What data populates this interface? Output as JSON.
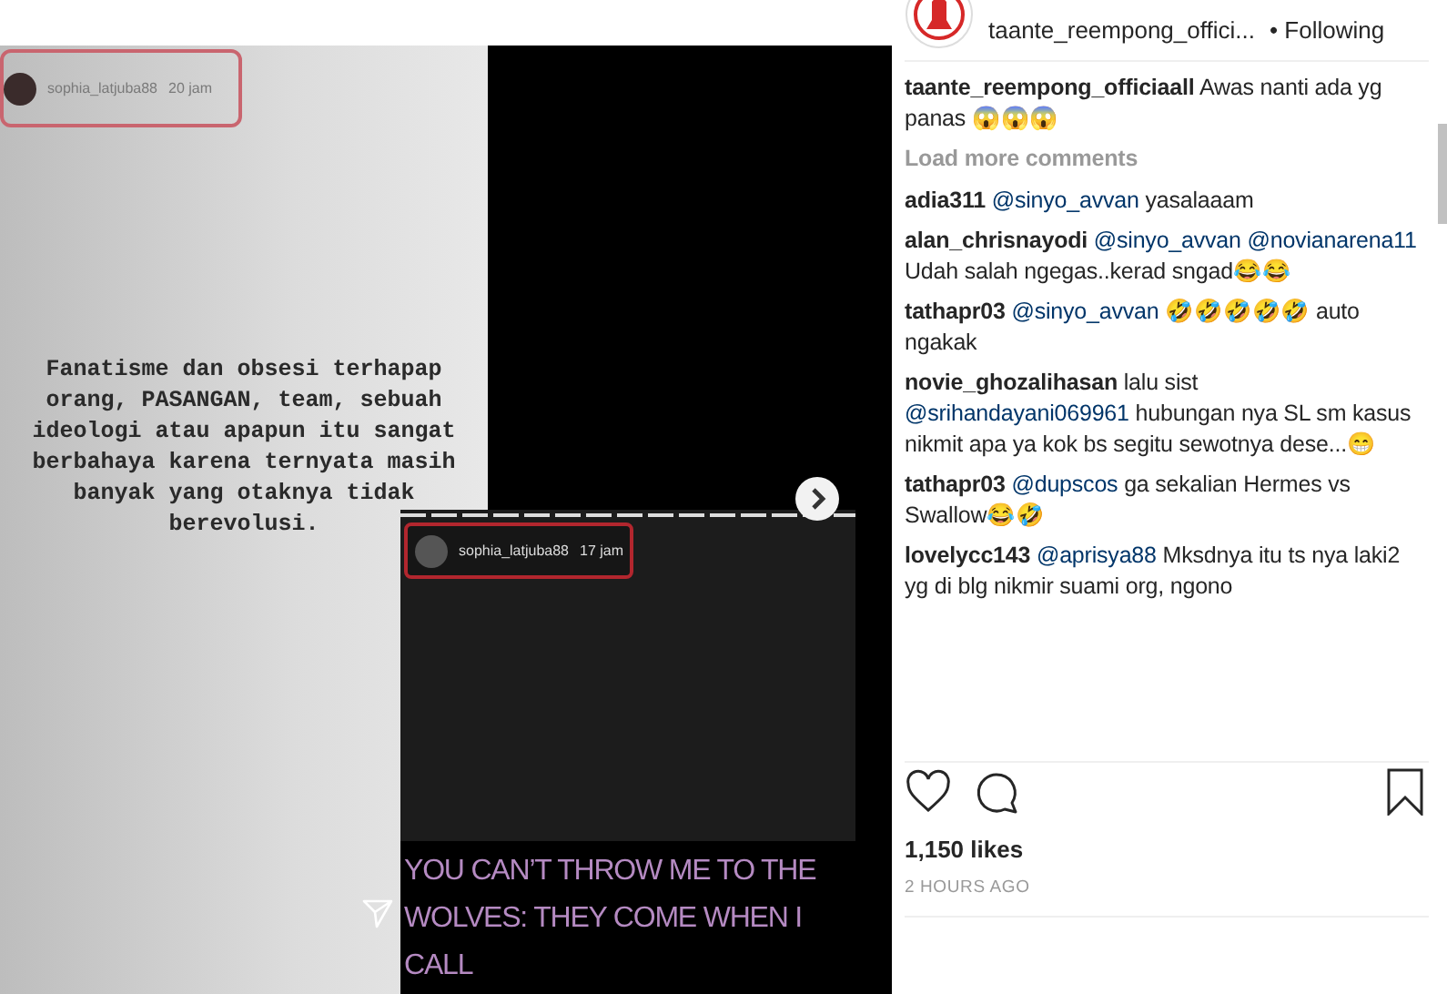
{
  "story": {
    "header": {
      "user": "sophia_latjuba88",
      "time": "20 jam"
    },
    "caption": "Fanatisme dan obsesi terhapap orang, PASANGAN, team, sebuah ideologi atau apapun itu sangat berbahaya karena ternyata masih banyak yang otaknya tidak berevolusi.",
    "inset": {
      "user": "sophia_latjuba88",
      "time": "17 jam",
      "quote": "YOU CAN’T THROW ME TO THE WOLVES: THEY COME WHEN I CALL"
    }
  },
  "post": {
    "account": "taante_reempong_offici...",
    "follow_status": "• Following",
    "caption": {
      "user": "taante_reempong_officiaall",
      "parts": [
        {
          "kind": "text",
          "text": "Awas nanti ada yg panas 😱😱😱"
        }
      ]
    },
    "load_more": "Load more comments",
    "comments": [
      {
        "user": "adia311",
        "parts": [
          {
            "kind": "mention",
            "text": "@sinyo_avvan"
          },
          {
            "kind": "text",
            "text": "yasalaaam"
          }
        ]
      },
      {
        "user": "alan_chrisnayodi",
        "parts": [
          {
            "kind": "mention",
            "text": "@sinyo_avvan"
          },
          {
            "kind": "mention",
            "text": "@novianarena11"
          },
          {
            "kind": "text",
            "text": "Udah salah ngegas..kerad sngad😂😂"
          }
        ]
      },
      {
        "user": "tathapr03",
        "parts": [
          {
            "kind": "mention",
            "text": "@sinyo_avvan"
          },
          {
            "kind": "text",
            "text": "🤣🤣🤣🤣🤣 auto ngakak"
          }
        ]
      },
      {
        "user": "novie_ghozalihasan",
        "parts": [
          {
            "kind": "text",
            "text": "lalu sist"
          },
          {
            "kind": "mention",
            "text": "@srihandayani069961"
          },
          {
            "kind": "text",
            "text": "hubungan nya SL sm kasus nikmit apa ya kok bs segitu sewotnya dese...😁"
          }
        ]
      },
      {
        "user": "tathapr03",
        "parts": [
          {
            "kind": "mention",
            "text": "@dupscos"
          },
          {
            "kind": "text",
            "text": "ga sekalian Hermes vs Swallow😂🤣"
          }
        ]
      },
      {
        "user": "lovelycc143",
        "parts": [
          {
            "kind": "mention",
            "text": "@aprisya88"
          },
          {
            "kind": "text",
            "text": "Mksdnya itu ts nya laki2 yg di blg nikmir suami org, ngono"
          }
        ]
      }
    ],
    "likes": "1,150 likes",
    "time": "2 HOURS AGO"
  }
}
